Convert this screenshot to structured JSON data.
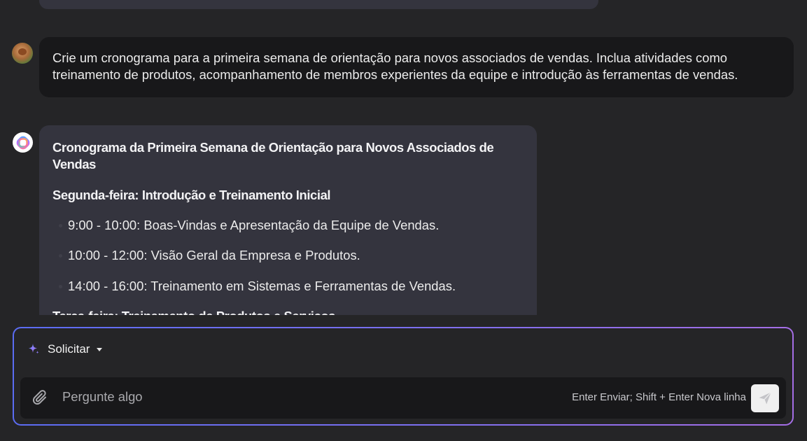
{
  "messages": {
    "user": {
      "text": "Crie um cronograma para a primeira semana de orientação para novos associados de vendas. Inclua atividades como treinamento de produtos, acompanhamento de membros experientes da equipe e introdução às ferramentas de vendas."
    },
    "assistant": {
      "title": "Cronograma da Primeira Semana de Orientação para Novos Associados de Vendas",
      "day1": "Segunda-feira: Introdução e Treinamento Inicial",
      "items": [
        "9:00 - 10:00: Boas-Vindas e Apresentação da Equipe de Vendas.",
        "10:00 - 12:00: Visão Geral da Empresa e Produtos.",
        "14:00 - 16:00: Treinamento em Sistemas e Ferramentas de Vendas."
      ],
      "day2": "Terça-feira: Treinamento de Produtos e Serviços"
    }
  },
  "composer": {
    "mode_label": "Solicitar",
    "placeholder": "Pergunte algo",
    "hint": "Enter Enviar; Shift + Enter Nova linha",
    "icons": {
      "mode": "sparkle-icon",
      "mode_caret": "caret-down-icon",
      "attach": "paperclip-icon",
      "send": "send-icon"
    }
  },
  "colors": {
    "background": "#252527",
    "user_bubble": "#18181a",
    "assistant_bubble": "#34343e",
    "accent_gradient_start": "#5b6cf2",
    "accent_gradient_end": "#a56ee6"
  }
}
